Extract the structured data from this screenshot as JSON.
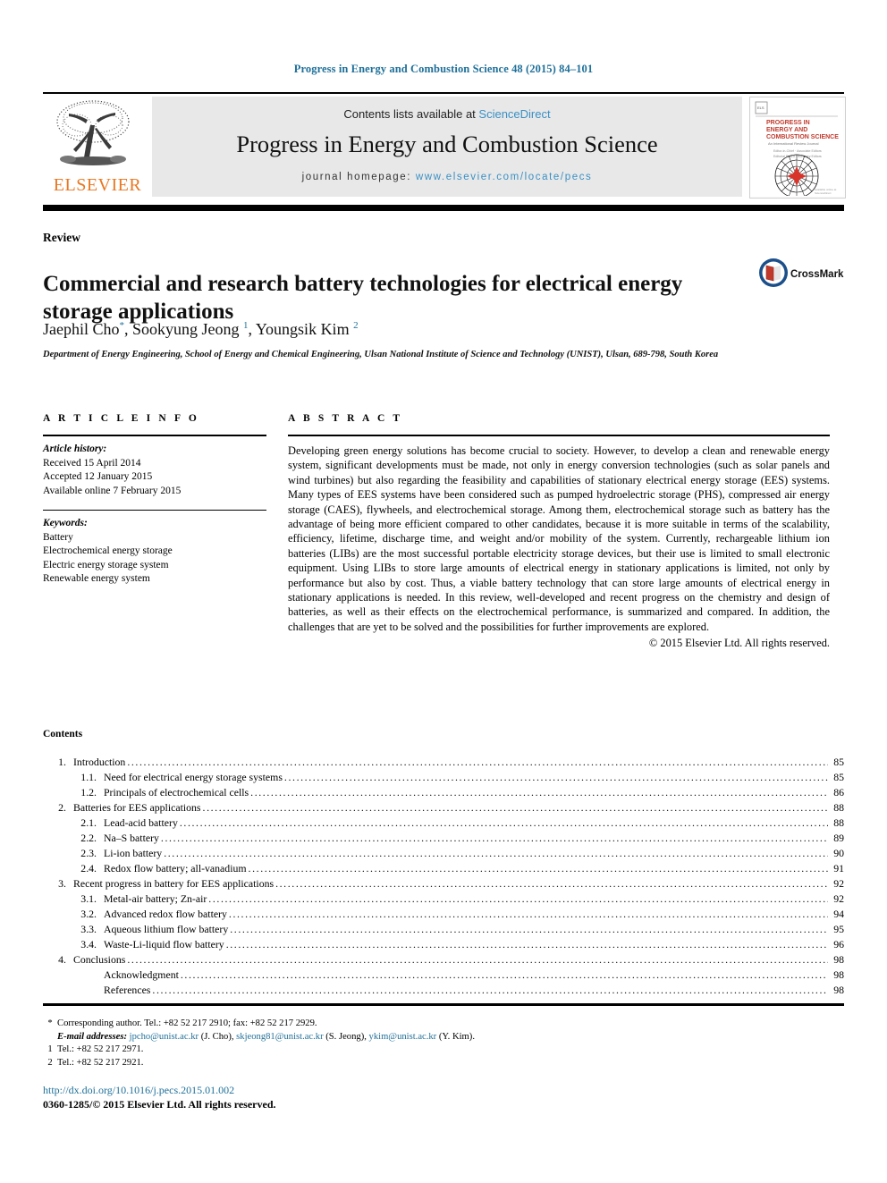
{
  "running_head": "Progress in Energy and Combustion Science 48 (2015) 84–101",
  "masthead": {
    "publisher_name": "ELSEVIER",
    "contents_prefix": "Contents lists available at ",
    "contents_link": "ScienceDirect",
    "journal_name": "Progress in Energy and Combustion Science",
    "homepage_prefix": "journal homepage: ",
    "homepage_url": "www.elsevier.com/locate/pecs",
    "cover_title_line1": "PROGRESS IN",
    "cover_title_line2": "ENERGY AND",
    "cover_title_line3": "COMBUSTION SCIENCE",
    "cover_subtitle": "An International Review Journal"
  },
  "article": {
    "doctype": "Review",
    "title": "Commercial and research battery technologies for electrical energy storage applications",
    "crossmark_label": "CrossMark",
    "authors": [
      {
        "name": "Jaephil Cho",
        "mark": "*"
      },
      {
        "name": "Sookyung Jeong",
        "mark": "1"
      },
      {
        "name": "Youngsik Kim",
        "mark": "2"
      }
    ],
    "affiliation": "Department of Energy Engineering, School of Energy and Chemical Engineering, Ulsan National Institute of Science and Technology (UNIST), Ulsan, 689-798, South Korea"
  },
  "article_info": {
    "heading": "A R T I C L E  I N F O",
    "history_label": "Article history:",
    "history": [
      "Received 15 April 2014",
      "Accepted 12 January 2015",
      "Available online 7 February 2015"
    ],
    "keywords_label": "Keywords:",
    "keywords": [
      "Battery",
      "Electrochemical energy storage",
      "Electric energy storage system",
      "Renewable energy system"
    ]
  },
  "abstract": {
    "heading": "A B S T R A C T",
    "body": "Developing green energy solutions has become crucial to society. However, to develop a clean and renewable energy system, significant developments must be made, not only in energy conversion technologies (such as solar panels and wind turbines) but also regarding the feasibility and capabilities of stationary electrical energy storage (EES) systems. Many types of EES systems have been considered such as pumped hydroelectric storage (PHS), compressed air energy storage (CAES), flywheels, and electrochemical storage. Among them, electrochemical storage such as battery has the advantage of being more efficient compared to other candidates, because it is more suitable in terms of the scalability, efficiency, lifetime, discharge time, and weight and/or mobility of the system. Currently, rechargeable lithium ion batteries (LIBs) are the most successful portable electricity storage devices, but their use is limited to small electronic equipment. Using LIBs to store large amounts of electrical energy in stationary applications is limited, not only by performance but also by cost. Thus, a viable battery technology that can store large amounts of electrical energy in stationary applications is needed. In this review, well-developed and recent progress on the chemistry and design of batteries, as well as their effects on the electrochemical performance, is summarized and compared. In addition, the challenges that are yet to be solved and the possibilities for further improvements are explored.",
    "copyright": "© 2015 Elsevier Ltd. All rights reserved."
  },
  "contents": {
    "heading": "Contents",
    "entries": [
      {
        "num": "1.",
        "level": 1,
        "label": "Introduction",
        "page": "85"
      },
      {
        "num": "1.1.",
        "level": 2,
        "label": "Need for electrical energy storage systems",
        "page": "85"
      },
      {
        "num": "1.2.",
        "level": 2,
        "label": "Principals of electrochemical cells",
        "page": "86"
      },
      {
        "num": "2.",
        "level": 1,
        "label": "Batteries for EES applications",
        "page": "88"
      },
      {
        "num": "2.1.",
        "level": 2,
        "label": "Lead-acid battery",
        "page": "88"
      },
      {
        "num": "2.2.",
        "level": 2,
        "label": "Na–S battery",
        "page": "89"
      },
      {
        "num": "2.3.",
        "level": 2,
        "label": "Li-ion battery",
        "page": "90"
      },
      {
        "num": "2.4.",
        "level": 2,
        "label": "Redox flow battery; all-vanadium",
        "page": "91"
      },
      {
        "num": "3.",
        "level": 1,
        "label": "Recent progress in battery for EES applications",
        "page": "92"
      },
      {
        "num": "3.1.",
        "level": 2,
        "label": "Metal-air battery; Zn-air",
        "page": "92"
      },
      {
        "num": "3.2.",
        "level": 2,
        "label": "Advanced redox flow battery",
        "page": "94"
      },
      {
        "num": "3.3.",
        "level": 2,
        "label": "Aqueous lithium flow battery",
        "page": "95"
      },
      {
        "num": "3.4.",
        "level": 2,
        "label": "Waste-Li-liquid flow battery",
        "page": "96"
      },
      {
        "num": "4.",
        "level": 1,
        "label": "Conclusions",
        "page": "98"
      },
      {
        "num": "",
        "level": 0,
        "label": "Acknowledgment",
        "page": "98"
      },
      {
        "num": "",
        "level": 0,
        "label": "References",
        "page": "98"
      }
    ]
  },
  "footnotes": {
    "corresponding": {
      "mark": "*",
      "text": "Corresponding author. Tel.: +82 52 217 2910; fax: +82 52 217 2929."
    },
    "emails": {
      "label": "E-mail addresses:",
      "items": [
        {
          "address": "jpcho@unist.ac.kr",
          "owner": "(J. Cho),"
        },
        {
          "address": "skjeong81@unist.ac.kr",
          "owner": "(S. Jeong),"
        },
        {
          "address": "ykim@unist.ac.kr",
          "owner": "(Y. Kim)."
        }
      ]
    },
    "tels": [
      {
        "mark": "1",
        "text": "Tel.: +82 52 217 2971."
      },
      {
        "mark": "2",
        "text": "Tel.: +82 52 217 2921."
      }
    ]
  },
  "footer": {
    "doi": "http://dx.doi.org/10.1016/j.pecs.2015.01.002",
    "issn_line": "0360-1285/© 2015 Elsevier Ltd. All rights reserved."
  },
  "colors": {
    "link": "#1f7099",
    "science_direct": "#3a90c4",
    "elsevier_orange": "#E87722",
    "masthead_bg": "#e8e8e8"
  }
}
